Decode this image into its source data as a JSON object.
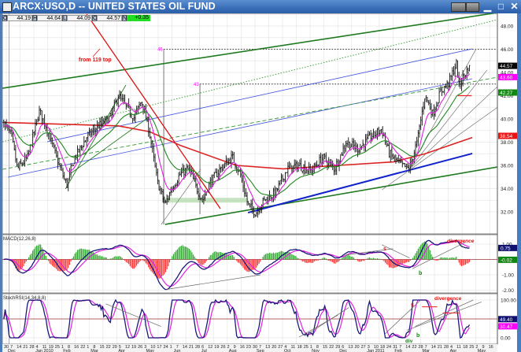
{
  "window": {
    "title": "ARCX:USO,D -- UNITED STATES OIL FUND"
  },
  "ohlc": {
    "o_label": "O",
    "open": "44.19",
    "h_label": "H",
    "high": "44.64",
    "l_label": "L",
    "low": "44.09",
    "c_label": "C",
    "close": "44.57",
    "n_label": "N",
    "change": "+0.35"
  },
  "colors": {
    "ema_fast": "#e020e0",
    "ema_slow": "#228822",
    "ma_long": "#dd2222",
    "price": "#111111",
    "channel_green": "#1f7a1f",
    "blue": "#3344cc",
    "macd": "#1a1a7a",
    "signal": "#e020e0",
    "hist_pos": "#33aa33",
    "hist_neg": "#ff3333"
  },
  "chart_data": {
    "type": "line",
    "title": "ARCX:USO,D -- UNITED STATES OIL FUND",
    "x_unit": "months since Dec 1 2009",
    "price_axis": {
      "ylim": [
        31,
        49.5
      ],
      "ticks": [
        "48.00",
        "46.00",
        "44.00",
        "42.00",
        "40.00",
        "38.00",
        "36.00",
        "34.00",
        "32.00"
      ],
      "tick_values": [
        48,
        46,
        44,
        42,
        40,
        38,
        36,
        34,
        32
      ]
    },
    "price_keypoints": [
      [
        -0.09,
        39.7
      ],
      [
        0.2,
        38.4
      ],
      [
        0.4,
        35.7
      ],
      [
        0.77,
        36.7
      ],
      [
        1.2,
        40.7
      ],
      [
        1.48,
        39.1
      ],
      [
        1.91,
        36.0
      ],
      [
        2.19,
        34.3
      ],
      [
        2.48,
        36.7
      ],
      [
        2.91,
        38.4
      ],
      [
        3.33,
        39.4
      ],
      [
        3.76,
        40.1
      ],
      [
        4.05,
        42.0
      ],
      [
        4.33,
        41.1
      ],
      [
        4.62,
        40.1
      ],
      [
        4.9,
        41.6
      ],
      [
        5.19,
        38.7
      ],
      [
        5.47,
        34.6
      ],
      [
        5.75,
        32.6
      ],
      [
        5.98,
        34.0
      ],
      [
        6.32,
        35.3
      ],
      [
        6.61,
        35.7
      ],
      [
        6.89,
        34.0
      ],
      [
        7.12,
        33.0
      ],
      [
        7.32,
        34.3
      ],
      [
        7.75,
        35.7
      ],
      [
        8.18,
        36.7
      ],
      [
        8.46,
        35.3
      ],
      [
        8.75,
        32.6
      ],
      [
        9.03,
        31.9
      ],
      [
        9.32,
        33.0
      ],
      [
        9.74,
        33.6
      ],
      [
        10.17,
        35.7
      ],
      [
        10.6,
        36.0
      ],
      [
        11.03,
        35.5
      ],
      [
        11.45,
        36.7
      ],
      [
        11.88,
        35.7
      ],
      [
        12.31,
        38.0
      ],
      [
        12.74,
        37.4
      ],
      [
        13.16,
        38.4
      ],
      [
        13.59,
        39.1
      ],
      [
        13.87,
        37.0
      ],
      [
        14.3,
        36.0
      ],
      [
        14.59,
        35.7
      ],
      [
        14.87,
        38.0
      ],
      [
        15.16,
        42.1
      ],
      [
        15.44,
        40.4
      ],
      [
        15.73,
        42.4
      ],
      [
        16.01,
        43.1
      ],
      [
        16.3,
        44.8
      ],
      [
        16.38,
        42.8
      ],
      [
        16.58,
        43.8
      ],
      [
        16.81,
        44.57
      ]
    ],
    "ma200_keypoints": [
      [
        -0.14,
        39.7
      ],
      [
        4.05,
        39.4
      ],
      [
        5.19,
        38.9
      ],
      [
        6.32,
        37.7
      ],
      [
        8.32,
        36.0
      ],
      [
        10.03,
        35.7
      ],
      [
        12.03,
        36.0
      ],
      [
        14.02,
        36.3
      ],
      [
        15.16,
        37.0
      ],
      [
        16.87,
        38.4
      ]
    ],
    "price_tags": [
      {
        "label": "44.57",
        "value": 44.57,
        "color": "#000000",
        "text": "#ffffff"
      },
      {
        "label": "43.60",
        "value": 43.6,
        "color": "#ff00ff",
        "text": "#ffffff"
      },
      {
        "label": "42.27",
        "value": 42.27,
        "color": "#118811",
        "text": "#ffffff"
      },
      {
        "label": "38.54",
        "value": 38.54,
        "color": "#ee1111",
        "text": "#ffffff"
      }
    ],
    "trendlines": [
      {
        "name": "green-upper-channel",
        "color": "#1f7a1f",
        "width": 1.6,
        "dash": "",
        "p": [
          [
            -0.14,
            42.64
          ],
          [
            17.78,
            49.15
          ]
        ]
      },
      {
        "name": "green-lower-channel",
        "color": "#1f7a1f",
        "width": 1.6,
        "dash": "",
        "p": [
          [
            5.75,
            30.92
          ],
          [
            17.78,
            35.86
          ]
        ]
      },
      {
        "name": "blue-bold-support",
        "color": "#1122cc",
        "width": 2,
        "dash": "",
        "p": [
          [
            8.75,
            31.93
          ],
          [
            16.87,
            37.02
          ]
        ]
      },
      {
        "name": "blue-thin-lower",
        "color": "#4455dd",
        "width": 0.8,
        "dash": "",
        "p": [
          [
            0.06,
            34.98
          ],
          [
            16.87,
            43.46
          ]
        ]
      },
      {
        "name": "blue-thin-upper",
        "color": "#4455dd",
        "width": 0.8,
        "dash": "",
        "p": [
          [
            1.48,
            38.03
          ],
          [
            16.87,
            46.03
          ]
        ]
      },
      {
        "name": "green-dashed-mid",
        "color": "#339933",
        "width": 0.9,
        "dash": "5,3",
        "p": [
          [
            -0.14,
            35.66
          ],
          [
            17.78,
            43.59
          ]
        ]
      },
      {
        "name": "green-dotted-upper",
        "color": "#339933",
        "width": 0.9,
        "dash": "1.5,2",
        "p": [
          [
            -0.14,
            38.03
          ],
          [
            17.78,
            48.54
          ]
        ]
      },
      {
        "name": "red-downtrend",
        "color": "#dd1111",
        "width": 1.3,
        "dash": "",
        "p": [
          [
            2.91,
            49.02
          ],
          [
            7.75,
            32.27
          ]
        ]
      },
      {
        "name": "green-short-channel-a",
        "color": "#1f7a1f",
        "width": 0.9,
        "dash": "",
        "p": [
          [
            2.14,
            33.97
          ],
          [
            4.33,
            42.92
          ]
        ]
      },
      {
        "name": "green-short-channel-b",
        "color": "#1f7a1f",
        "width": 0.9,
        "dash": "",
        "p": [
          [
            2.34,
            35.32
          ],
          [
            5.19,
            40.2
          ]
        ]
      },
      {
        "name": "gray-channel-a",
        "color": "#777777",
        "width": 0.7,
        "dash": "",
        "p": [
          [
            14.59,
            35.66
          ],
          [
            17.01,
            46.03
          ]
        ]
      },
      {
        "name": "gray-channel-b",
        "color": "#777777",
        "width": 0.7,
        "dash": "",
        "p": [
          [
            14.59,
            35.66
          ],
          [
            17.78,
            42.78
          ]
        ]
      },
      {
        "name": "gray-channel-c",
        "color": "#777777",
        "width": 0.7,
        "dash": "",
        "p": [
          [
            14.59,
            35.66
          ],
          [
            17.4,
            44.2
          ]
        ]
      },
      {
        "name": "gray-channel-d",
        "color": "#777777",
        "width": 0.7,
        "dash": "",
        "p": [
          [
            13.6,
            33.9
          ],
          [
            17.78,
            41.0
          ]
        ]
      },
      {
        "name": "gray-rebound-line",
        "color": "#777777",
        "width": 0.7,
        "dash": "",
        "p": [
          [
            5.61,
            30.92
          ],
          [
            7.04,
            35.66
          ]
        ]
      },
      {
        "name": "red-short-level",
        "color": "#ee2222",
        "width": 1.2,
        "dash": "",
        "p": [
          [
            16.35,
            42.0
          ],
          [
            16.85,
            42.0
          ]
        ]
      }
    ],
    "levels": [
      {
        "label": "46",
        "value": 46,
        "from": 5.7,
        "to": 17.78
      },
      {
        "label": "43",
        "value": 43,
        "from": 7.01,
        "to": 17.78
      }
    ],
    "band": {
      "value": 33,
      "from": 5.75,
      "to": 8.75
    },
    "annotations": {
      "main": "from 119 top",
      "macd_divergence": "divergence",
      "macd_s": "s",
      "macd_b": "b",
      "stoch_divergence": "divergence",
      "stoch_s": "s",
      "stoch_b": "b",
      "stoch_div": "div"
    },
    "macd": {
      "label": "MACD(12,26,8)",
      "ticks": [
        "1.00",
        "-1.00",
        "-2.00"
      ],
      "tick_values": [
        1,
        -1,
        -2
      ],
      "tags": [
        {
          "label": "0.75",
          "value": 0.75,
          "color": "#101070"
        },
        {
          "label": "-0.02",
          "value": -0.02,
          "color": "#118811"
        }
      ]
    },
    "stoch": {
      "label": "StochRSI(14,34,8,8)",
      "ticks": [
        "100.00",
        "0.00"
      ],
      "tick_values": [
        1,
        0
      ],
      "tags": [
        {
          "label": "49.40",
          "value": 0.494,
          "color": "#101070"
        },
        {
          "label": "30.47",
          "value": 0.3047,
          "color": "#ff00ff"
        }
      ]
    },
    "x_days": [
      "30",
      "7",
      "14",
      "21",
      "28",
      "4",
      "11",
      "19",
      "25",
      "1",
      "8",
      "16",
      "22",
      "1",
      "8",
      "15",
      "22",
      "29",
      "5",
      "12",
      "19",
      "26",
      "3",
      "10",
      "17",
      "24",
      "1",
      "7",
      "14",
      "21",
      "28",
      "6",
      "12",
      "19",
      "26",
      "2",
      "9",
      "16",
      "23",
      "30",
      "7",
      "13",
      "20",
      "27",
      "4",
      "11",
      "18",
      "25",
      "1",
      "8",
      "15",
      "22",
      "29",
      "6",
      "13",
      "20",
      "27",
      "3",
      "10",
      "18",
      "24",
      "31",
      "7",
      "14",
      "22",
      "28",
      "7",
      "14",
      "21",
      "28",
      "4",
      "11",
      "18",
      "25",
      "2",
      "9",
      "16"
    ],
    "x_months": [
      {
        "label": "Dec",
        "t": 0
      },
      {
        "label": "Jan 2010",
        "t": 1
      },
      {
        "label": "Feb",
        "t": 2
      },
      {
        "label": "Mar",
        "t": 3
      },
      {
        "label": "Apr",
        "t": 4
      },
      {
        "label": "May",
        "t": 5
      },
      {
        "label": "Jun",
        "t": 6
      },
      {
        "label": "Jul",
        "t": 7
      },
      {
        "label": "Aug",
        "t": 8
      },
      {
        "label": "Sep",
        "t": 9
      },
      {
        "label": "Oct",
        "t": 10
      },
      {
        "label": "Nov",
        "t": 11
      },
      {
        "label": "Dec",
        "t": 12
      },
      {
        "label": "Jan 2011",
        "t": 13
      },
      {
        "label": "Feb",
        "t": 14
      },
      {
        "label": "Mar",
        "t": 15
      },
      {
        "label": "Apr",
        "t": 16
      },
      {
        "label": "May",
        "t": 17
      }
    ]
  }
}
